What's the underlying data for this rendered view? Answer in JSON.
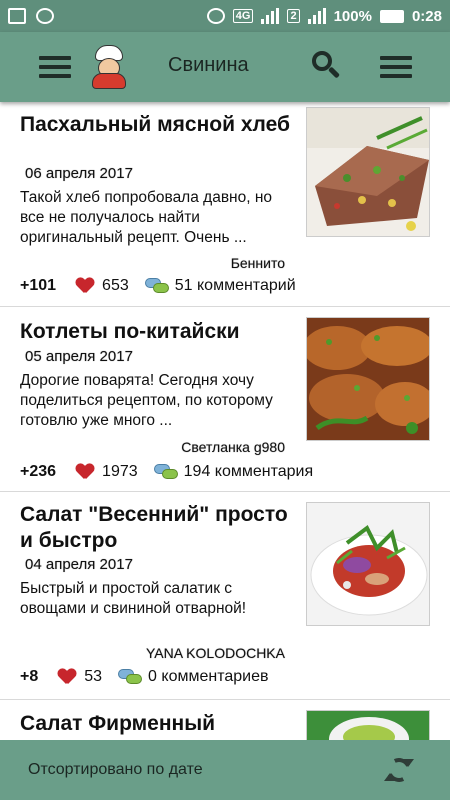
{
  "status_bar": {
    "network": "4G",
    "sim": "2",
    "battery": "100%",
    "time": "0:28",
    "icons": [
      "image-icon",
      "sync-icon",
      "alarm-icon",
      "data-arrows-icon",
      "signal-icon",
      "signal-icon",
      "battery-icon"
    ]
  },
  "appbar": {
    "title": "Свинина",
    "icons": [
      "hamburger-menu-icon",
      "chef-logo",
      "search-icon",
      "overflow-menu-icon"
    ]
  },
  "recipes": [
    {
      "title": "Пасхальный мясной хлеб",
      "date": "06 апреля 2017",
      "description": "Такой хлеб попробовала давно, но все не получалось найти оригинальный рецепт. Очень ...",
      "author": "Беннито",
      "score": "+101",
      "likes": "653",
      "comments": "51 комментарий"
    },
    {
      "title": "Котлеты по-китайски",
      "date": "05 апреля 2017",
      "description": "Дорогие поварята! Сегодня хочу поделиться рецептом, по которому готовлю уже много ...",
      "author": "Светланка g980",
      "score": "+236",
      "likes": "1973",
      "comments": "194 комментария"
    },
    {
      "title": "Салат \"Весенний\" просто и быстро",
      "date": "04 апреля 2017",
      "description": "Быстрый и простой салатик с овощами и свининой отварной!",
      "author": "YANA KOLODOCHKA",
      "score": "+8",
      "likes": "53",
      "comments": "0 комментариев"
    },
    {
      "title": "Салат Фирменный",
      "date": "",
      "description": "",
      "author": "",
      "score": "",
      "likes": "",
      "comments": ""
    }
  ],
  "bottom_bar": {
    "sort_label": "Отсортировано по дате",
    "icon": "refresh-icon"
  },
  "colors": {
    "status_bar": "#5f8f7c",
    "app_bar": "#6a9e89",
    "heart": "#c7262c"
  }
}
